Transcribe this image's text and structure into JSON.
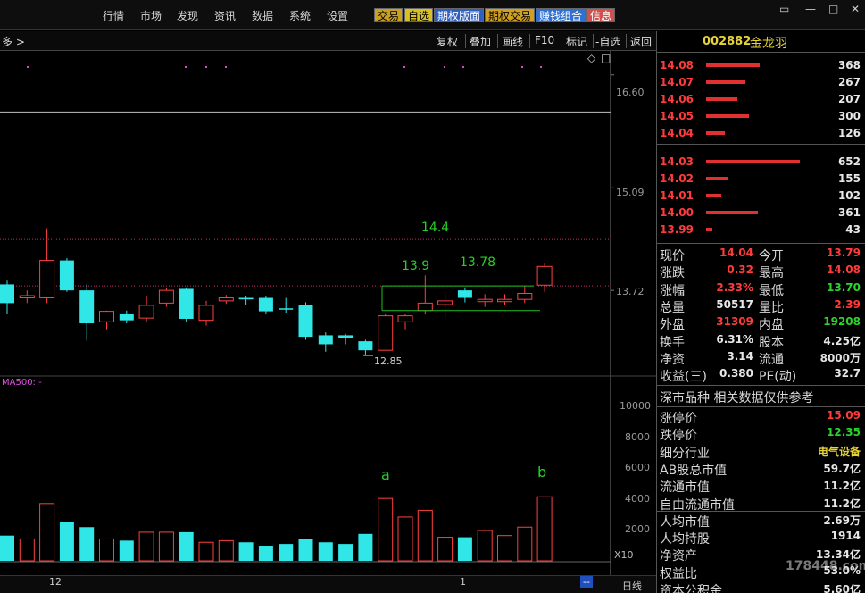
{
  "menu": [
    "行情",
    "市场",
    "发现",
    "资讯",
    "数据",
    "系统",
    "设置"
  ],
  "tags": [
    {
      "label": "交易",
      "bg": "#c9a020",
      "fg": "#000000"
    },
    {
      "label": "自选",
      "bg": "#d8c020",
      "fg": "#000000"
    },
    {
      "label": "期权版面",
      "bg": "#2f5fc0",
      "fg": "#ffffff"
    },
    {
      "label": "期权交易",
      "bg": "#d0a020",
      "fg": "#000000"
    },
    {
      "label": "赚钱组合",
      "bg": "#3070d0",
      "fg": "#ffffff"
    },
    {
      "label": "信息",
      "bg": "#d05050",
      "fg": "#ffffff"
    }
  ],
  "window_controls": {
    "min": "—",
    "max": "□",
    "close": "✕",
    "extra": "▭"
  },
  "toolbar": {
    "left_text": "多 >",
    "buttons": [
      "复权",
      "叠加",
      "画线",
      "F10",
      "标记",
      "-自选",
      "返回"
    ]
  },
  "chart": {
    "diamond_icon": "◇",
    "square_icon": "□",
    "price_ticks": [
      "16.60",
      "15.09",
      "13.72"
    ],
    "volume_ticks": [
      "10000",
      "8000",
      "6000",
      "4000",
      "2000"
    ],
    "x_multiplier": "X10",
    "date_labels": [
      "12",
      "1"
    ],
    "ma_label": "MA500: -",
    "annotations": {
      "a": "a",
      "b": "b",
      "level_14_4": "14.4",
      "level_13_9": "13.9",
      "level_13_78": "13.78",
      "low_12_85": "12.85"
    }
  },
  "chart_data": {
    "type": "candlestick",
    "candles": [
      {
        "o": 13.55,
        "h": 13.85,
        "l": 13.4,
        "c": 13.8,
        "up": false
      },
      {
        "o": 13.62,
        "h": 13.72,
        "l": 13.55,
        "c": 13.65,
        "up": true
      },
      {
        "o": 13.62,
        "h": 14.55,
        "l": 13.55,
        "c": 14.12,
        "up": true
      },
      {
        "o": 14.12,
        "h": 14.15,
        "l": 13.7,
        "c": 13.72,
        "up": false
      },
      {
        "o": 13.72,
        "h": 13.8,
        "l": 13.05,
        "c": 13.28,
        "up": false
      },
      {
        "o": 13.3,
        "h": 13.45,
        "l": 13.2,
        "c": 13.44,
        "up": true
      },
      {
        "o": 13.4,
        "h": 13.45,
        "l": 13.28,
        "c": 13.32,
        "up": false
      },
      {
        "o": 13.35,
        "h": 13.65,
        "l": 13.3,
        "c": 13.52,
        "up": true
      },
      {
        "o": 13.55,
        "h": 13.75,
        "l": 13.5,
        "c": 13.72,
        "up": true
      },
      {
        "o": 13.74,
        "h": 13.76,
        "l": 13.3,
        "c": 13.34,
        "up": false
      },
      {
        "o": 13.32,
        "h": 13.58,
        "l": 13.25,
        "c": 13.52,
        "up": true
      },
      {
        "o": 13.58,
        "h": 13.66,
        "l": 13.54,
        "c": 13.62,
        "up": true
      },
      {
        "o": 13.62,
        "h": 13.64,
        "l": 13.52,
        "c": 13.6,
        "up": false
      },
      {
        "o": 13.62,
        "h": 13.65,
        "l": 13.4,
        "c": 13.44,
        "up": false
      },
      {
        "o": 13.47,
        "h": 13.62,
        "l": 13.42,
        "c": 13.48,
        "up": false
      },
      {
        "o": 13.52,
        "h": 13.56,
        "l": 13.06,
        "c": 13.1,
        "up": false
      },
      {
        "o": 13.12,
        "h": 13.16,
        "l": 12.9,
        "c": 13.0,
        "up": false
      },
      {
        "o": 13.12,
        "h": 13.14,
        "l": 13.0,
        "c": 13.08,
        "up": false
      },
      {
        "o": 13.04,
        "h": 13.06,
        "l": 12.85,
        "c": 12.92,
        "up": false
      },
      {
        "o": 12.92,
        "h": 13.4,
        "l": 12.92,
        "c": 13.38,
        "up": true
      },
      {
        "o": 13.3,
        "h": 13.4,
        "l": 13.2,
        "c": 13.38,
        "up": true
      },
      {
        "o": 13.45,
        "h": 13.92,
        "l": 13.4,
        "c": 13.55,
        "up": true
      },
      {
        "o": 13.53,
        "h": 13.68,
        "l": 13.35,
        "c": 13.58,
        "up": true
      },
      {
        "o": 13.72,
        "h": 13.76,
        "l": 13.56,
        "c": 13.62,
        "up": false
      },
      {
        "o": 13.57,
        "h": 13.67,
        "l": 13.5,
        "c": 13.6,
        "up": true
      },
      {
        "o": 13.57,
        "h": 13.67,
        "l": 13.52,
        "c": 13.6,
        "up": true
      },
      {
        "o": 13.6,
        "h": 13.78,
        "l": 13.55,
        "c": 13.68,
        "up": true
      },
      {
        "o": 13.79,
        "h": 14.08,
        "l": 13.7,
        "c": 14.04,
        "up": true
      }
    ],
    "volumes": [
      1500,
      1300,
      3400,
      2300,
      2000,
      1300,
      1200,
      1700,
      1700,
      1700,
      1100,
      1200,
      1100,
      900,
      1000,
      1300,
      1100,
      1000,
      1600,
      3700,
      2600,
      3000,
      1400,
      1400,
      1800,
      1500,
      2000,
      3800
    ],
    "levels": [
      {
        "value": 14.4,
        "label": "14.4",
        "style": "dotted"
      },
      {
        "value": 13.78,
        "label": "13.78",
        "style": "dotted"
      },
      {
        "value": 16.1,
        "label": "",
        "style": "solid"
      }
    ],
    "price_range": [
      12.6,
      16.8
    ],
    "volume_range": [
      0,
      8000
    ]
  },
  "bottombar": {
    "items": [
      "12",
      "1",
      "日线"
    ],
    "dash": "--"
  },
  "stock": {
    "code": "002882",
    "name": "金龙羽"
  },
  "orderbook": {
    "asks": [
      {
        "price": "14.08",
        "volume": "368"
      },
      {
        "price": "14.07",
        "volume": "267"
      },
      {
        "price": "14.06",
        "volume": "207"
      },
      {
        "price": "14.05",
        "volume": "300"
      },
      {
        "price": "14.04",
        "volume": "126"
      }
    ],
    "bids": [
      {
        "price": "14.03",
        "volume": "652"
      },
      {
        "price": "14.02",
        "volume": "155"
      },
      {
        "price": "14.01",
        "volume": "102"
      },
      {
        "price": "14.00",
        "volume": "361"
      },
      {
        "price": "13.99",
        "volume": "43"
      }
    ],
    "ask_bar_fracs": [
      0.57,
      0.42,
      0.33,
      0.46,
      0.2
    ],
    "bid_bar_fracs": [
      1.0,
      0.23,
      0.16,
      0.55,
      0.07
    ]
  },
  "quote": [
    {
      "l1": "现价",
      "v1": "14.04",
      "c1": "red",
      "l2": "今开",
      "v2": "13.79",
      "c2": "red"
    },
    {
      "l1": "涨跌",
      "v1": "0.32",
      "c1": "red",
      "l2": "最高",
      "v2": "14.08",
      "c2": "red"
    },
    {
      "l1": "涨幅",
      "v1": "2.33%",
      "c1": "red",
      "l2": "最低",
      "v2": "13.70",
      "c2": "green"
    },
    {
      "l1": "总量",
      "v1": "50517",
      "c1": "white",
      "l2": "量比",
      "v2": "2.39",
      "c2": "red"
    },
    {
      "l1": "外盘",
      "v1": "31309",
      "c1": "red",
      "l2": "内盘",
      "v2": "19208",
      "c2": "green"
    },
    {
      "l1": "换手",
      "v1": "6.31%",
      "c1": "white",
      "l2": "股本",
      "v2": "4.25亿",
      "c2": "white"
    },
    {
      "l1": "净资",
      "v1": "3.14",
      "c1": "white",
      "l2": "流通",
      "v2": "8000万",
      "c2": "white"
    },
    {
      "l1": "收益(三)",
      "v1": "0.380",
      "c1": "white",
      "l2": "PE(动)",
      "v2": "32.7",
      "c2": "white"
    }
  ],
  "info": {
    "market_note": "深市品种 相关数据仅供参考",
    "rows": [
      {
        "label": "涨停价",
        "value": "15.09",
        "color": "red"
      },
      {
        "label": "跌停价",
        "value": "12.35",
        "color": "green"
      },
      {
        "label": "细分行业",
        "value": "电气设备",
        "color": "yellow"
      },
      {
        "label": "AB股总市值",
        "value": "59.7亿",
        "color": "white"
      },
      {
        "label": "流通市值",
        "value": "11.2亿",
        "color": "white"
      },
      {
        "label": "自由流通市值",
        "value": "11.2亿",
        "color": "white"
      },
      {
        "label": "人均市值",
        "value": "2.69万",
        "color": "white"
      },
      {
        "label": "人均持股",
        "value": "1914",
        "color": "white"
      },
      {
        "label": "净资产",
        "value": "13.34亿",
        "color": "white"
      },
      {
        "label": "权益比",
        "value": "53.0%",
        "color": "white"
      },
      {
        "label": "资本公积金",
        "value": "5.60亿",
        "color": "white"
      }
    ]
  },
  "watermark": "178448.com"
}
